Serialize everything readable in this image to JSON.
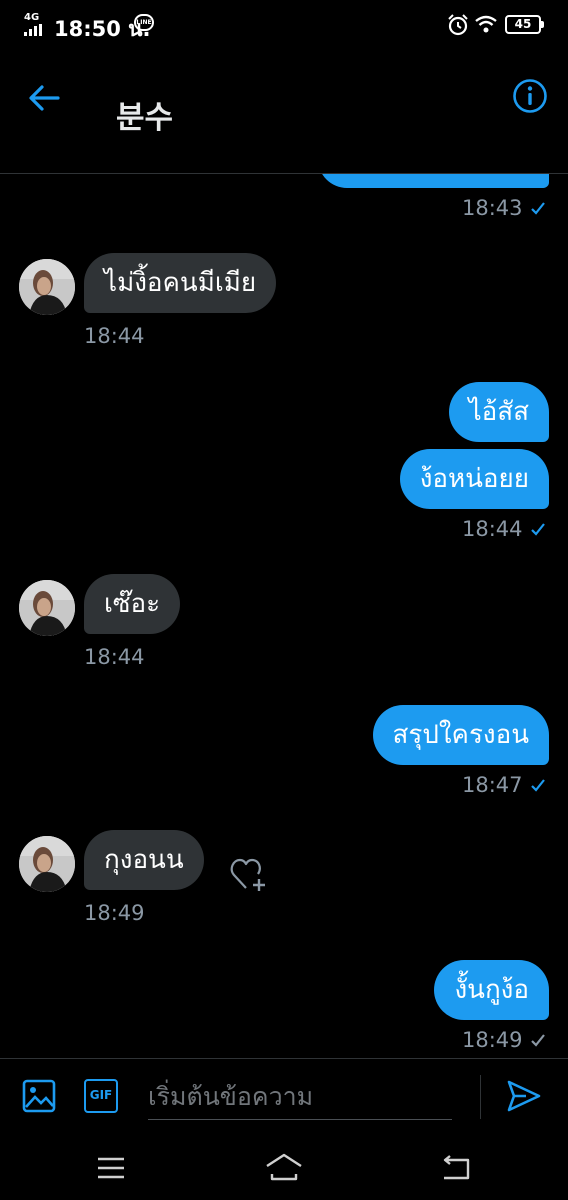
{
  "status_bar": {
    "network": "4G",
    "time": "18:50 น.",
    "line_badge": "LINE",
    "battery": "45"
  },
  "header": {
    "title": "분수"
  },
  "messages": [
    {
      "dir": "out",
      "text": "",
      "time": "18:43",
      "read": true
    },
    {
      "dir": "in",
      "text": "ไม่งิ้อคนมีเมีย",
      "time": "18:44"
    },
    {
      "dir": "out",
      "text": "ไอ้สัส",
      "time": ""
    },
    {
      "dir": "out",
      "text": "ง้อหน่อยย",
      "time": "18:44",
      "read": true
    },
    {
      "dir": "in",
      "text": "เซ๊อะ",
      "time": "18:44"
    },
    {
      "dir": "out",
      "text": "สรุปใครงอน",
      "time": "18:47",
      "read": true
    },
    {
      "dir": "in",
      "text": "กุงอนน",
      "time": "18:49"
    },
    {
      "dir": "out",
      "text": "งั้นกูง้อ",
      "time": "18:49",
      "read": false
    }
  ],
  "composer": {
    "placeholder": "เริ่มต้นข้อความ",
    "gif_label": "GIF"
  },
  "colors": {
    "accent": "#1d9bf0",
    "incoming_bubble": "#2f3336",
    "background": "#000000"
  }
}
